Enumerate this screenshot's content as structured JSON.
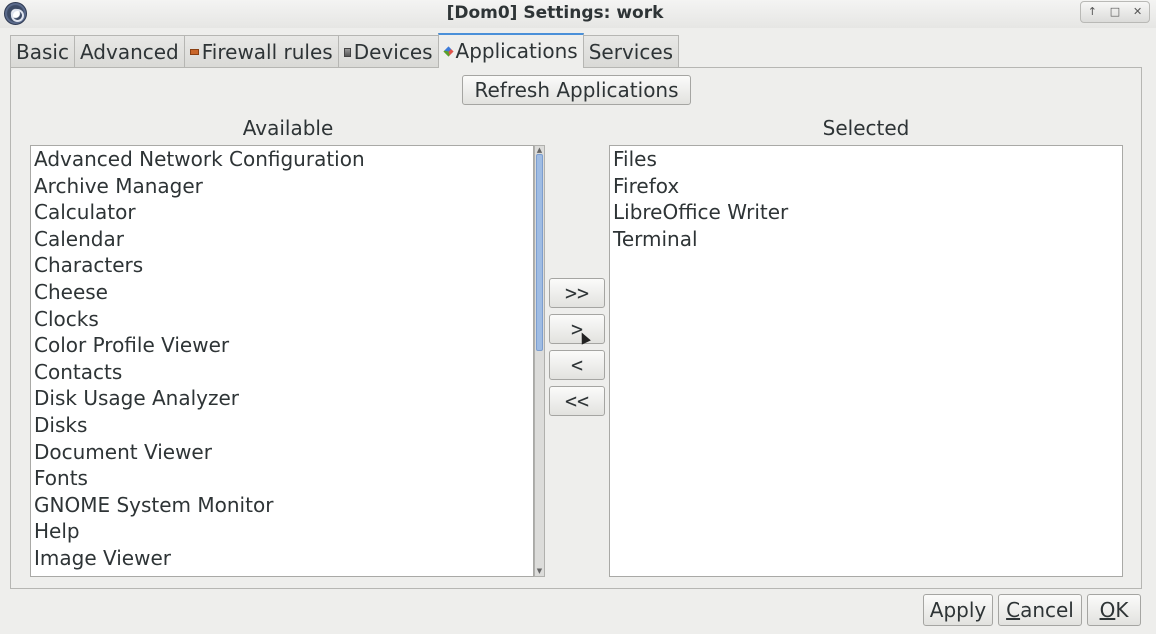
{
  "window": {
    "title": "[Dom0] Settings: work",
    "controls": [
      "↑",
      "□",
      "✕"
    ]
  },
  "tabs": [
    {
      "label": "Basic",
      "icon": null
    },
    {
      "label": "Advanced",
      "icon": null
    },
    {
      "label": "Firewall rules",
      "icon": "firewall-icon"
    },
    {
      "label": "Devices",
      "icon": "devices-icon"
    },
    {
      "label": "Applications",
      "icon": "applications-icon",
      "active": true
    },
    {
      "label": "Services",
      "icon": null
    }
  ],
  "refresh_label": "Refresh Applications",
  "available": {
    "label": "Available",
    "items": [
      "Advanced Network Configuration",
      "Archive Manager",
      "Calculator",
      "Calendar",
      "Characters",
      "Cheese",
      "Clocks",
      "Color Profile Viewer",
      "Contacts",
      "Disk Usage Analyzer",
      "Disks",
      "Document Viewer",
      "Fonts",
      "GNOME System Monitor",
      "Help",
      "Image Viewer"
    ]
  },
  "selected": {
    "label": "Selected",
    "items": [
      "Files",
      "Firefox",
      "LibreOffice Writer",
      "Terminal"
    ]
  },
  "move_buttons": {
    "all_right": ">>",
    "right": ">",
    "left": "<",
    "all_left": "<<"
  },
  "footer": {
    "apply": "Apply",
    "cancel_first": "C",
    "cancel_rest": "ancel",
    "ok_first": "O",
    "ok_rest": "K"
  }
}
